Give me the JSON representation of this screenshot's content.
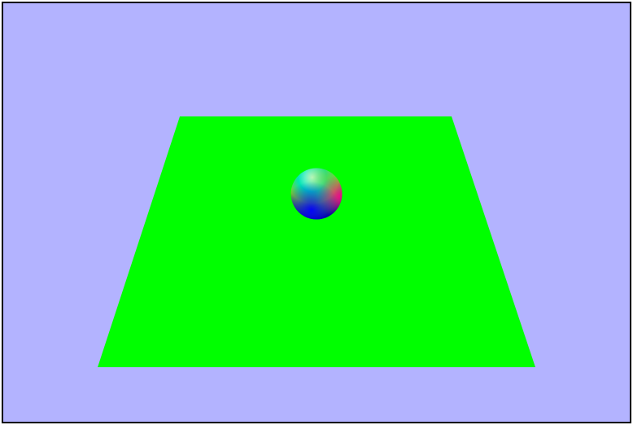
{
  "scene": {
    "colors": {
      "sky": "#b3b3ff",
      "ground": "#00ff00",
      "frame": "#000000"
    },
    "sphere": {
      "shading": "normal-map",
      "colors": {
        "light": "#c8ffdc",
        "cyan": "#00e6b4",
        "green": "#7dd12a",
        "magenta": "#ff0090",
        "blue": "#0000ff",
        "dark_blue": "#06007a"
      }
    }
  }
}
